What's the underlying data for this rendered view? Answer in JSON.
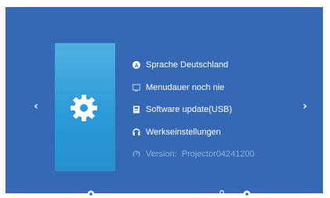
{
  "navigation": {
    "left_arrow": "‹",
    "right_arrow": "›"
  },
  "settings_card": {
    "icon": "gear-icon"
  },
  "menu": {
    "items": [
      {
        "icon": "language-icon",
        "label": "Sprache Deutschland"
      },
      {
        "icon": "menu-duration-icon",
        "label": "Menudauer noch nie"
      },
      {
        "icon": "usb-update-icon",
        "label": "Software update(USB)"
      },
      {
        "icon": "factory-reset-icon",
        "label": "Werkseinstellungen"
      }
    ],
    "version": {
      "icon": "info-icon",
      "label": "Version:",
      "value": "Projector04241200"
    }
  },
  "bottom_bar": {
    "icons": [
      "source-icon",
      "lock-icon",
      "settings-icon"
    ]
  },
  "colors": {
    "background": "#3569b6",
    "card_top": "#4fb0e0",
    "card_bottom": "#2590d2",
    "text": "#ffffff",
    "text_dim": "#8fb0de"
  }
}
